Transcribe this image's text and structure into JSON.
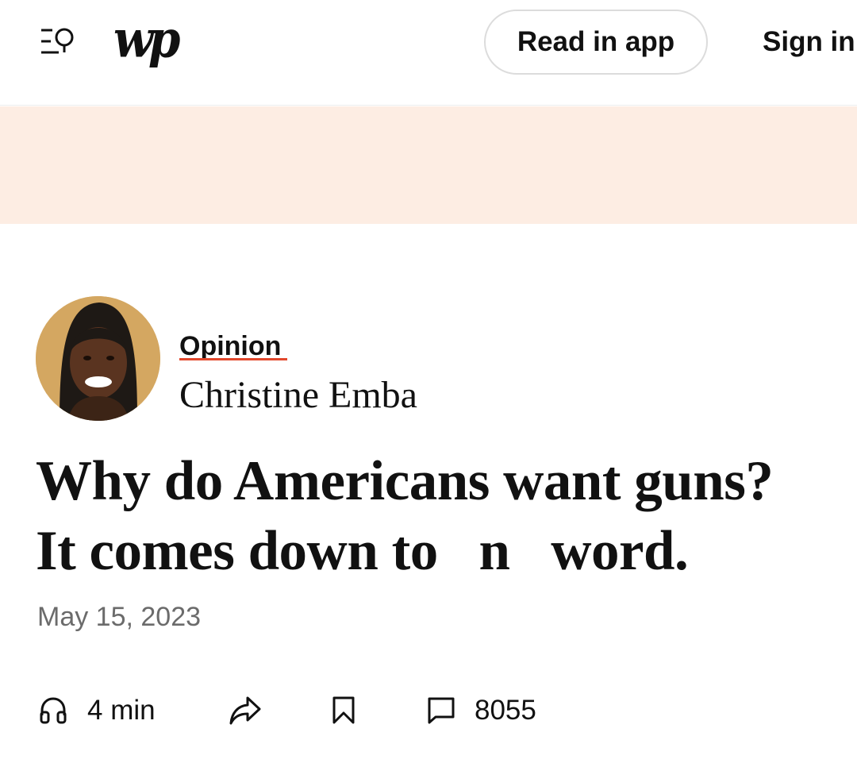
{
  "header": {
    "logo_text": "wp",
    "read_in_app_label": "Read in app",
    "sign_in_label": "Sign in"
  },
  "article": {
    "section_label": "Opinion",
    "author_name": "Christine Emba",
    "headline": "Why do Americans want guns?\nIt comes down to   n   word.",
    "date": "May 15, 2023"
  },
  "actions": {
    "listen_duration": "4 min",
    "comment_count": "8055"
  },
  "colors": {
    "ad_band": "#fdede3",
    "opinion_underline": "#e2482d",
    "avatar_background": "#d4a761"
  },
  "icons": [
    "menu-search-icon",
    "headphones-icon",
    "share-icon",
    "bookmark-icon",
    "comment-icon"
  ]
}
